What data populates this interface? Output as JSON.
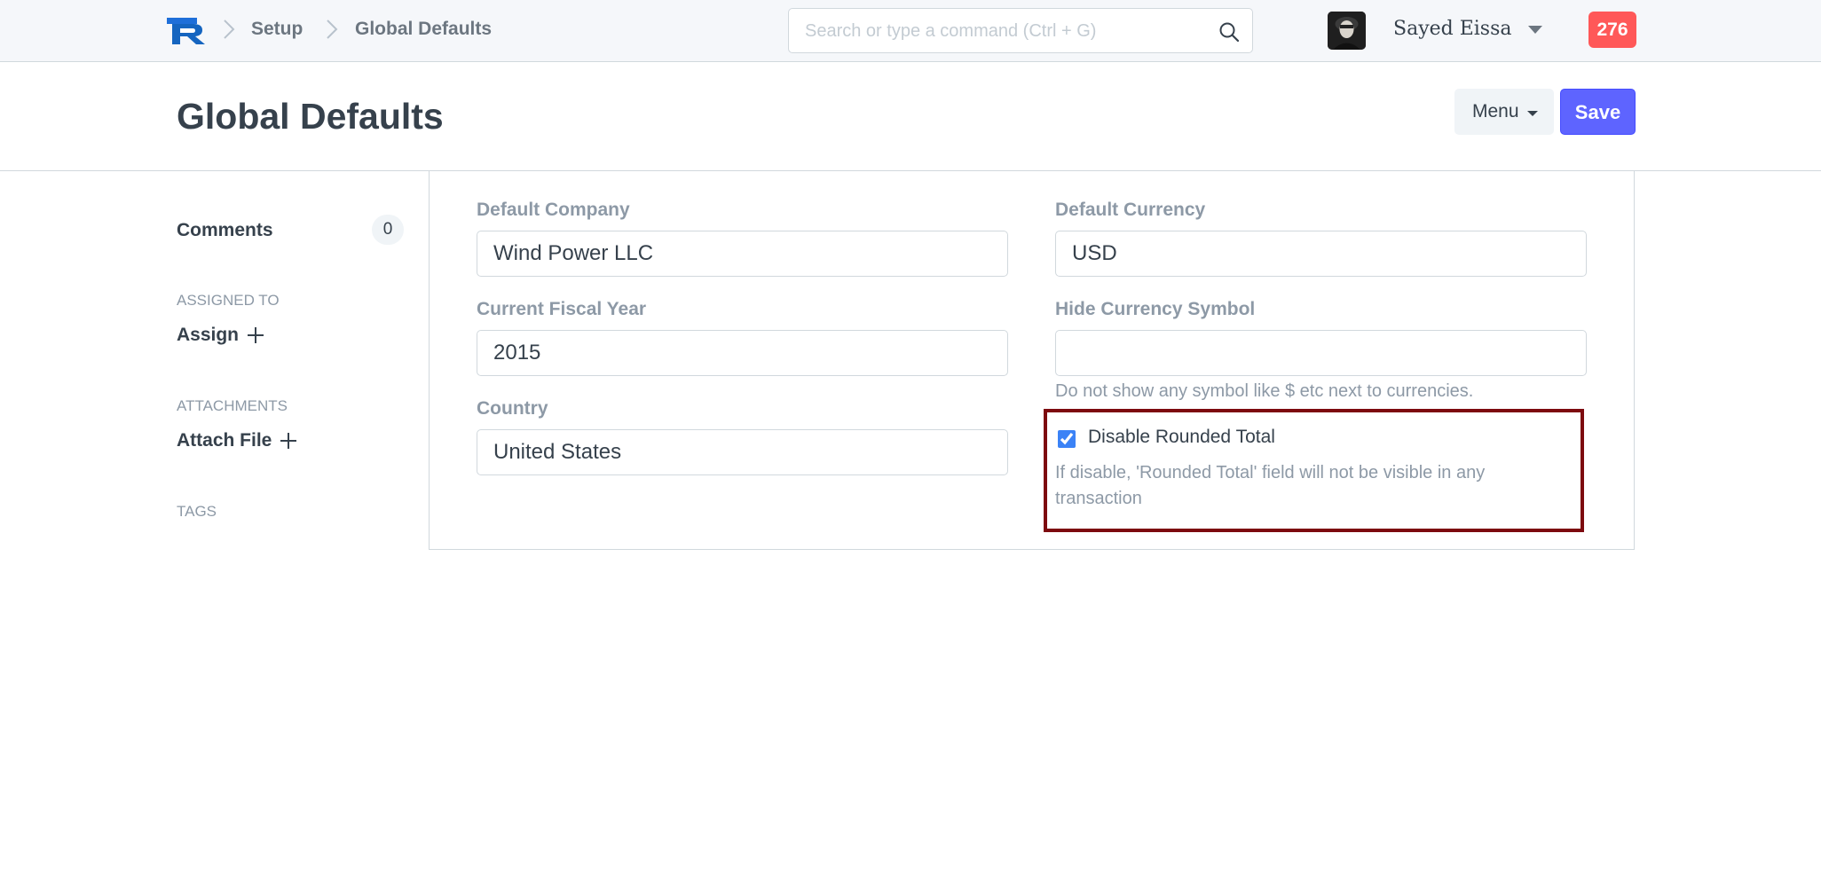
{
  "navbar": {
    "logo_letter": "R",
    "breadcrumbs": [
      "Setup",
      "Global Defaults"
    ],
    "search_placeholder": "Search or type a command (Ctrl + G)",
    "user_name": "Sayed Eissa",
    "notification_count": "276"
  },
  "page": {
    "title": "Global Defaults",
    "menu_label": "Menu",
    "save_label": "Save"
  },
  "sidebar": {
    "comments_label": "Comments",
    "comments_count": "0",
    "assigned_heading": "ASSIGNED TO",
    "assign_label": "Assign",
    "attachments_heading": "ATTACHMENTS",
    "attach_label": "Attach File",
    "tags_heading": "TAGS"
  },
  "form": {
    "default_company": {
      "label": "Default Company",
      "value": "Wind Power LLC"
    },
    "current_fiscal_year": {
      "label": "Current Fiscal Year",
      "value": "2015"
    },
    "country": {
      "label": "Country",
      "value": "United States"
    },
    "default_currency": {
      "label": "Default Currency",
      "value": "USD"
    },
    "hide_currency_symbol": {
      "label": "Hide Currency Symbol",
      "value": "",
      "help": "Do not show any symbol like $ etc next to currencies."
    },
    "disable_rounded_total": {
      "label": "Disable Rounded Total",
      "checked": true,
      "help": "If disable, 'Rounded Total' field will not be visible in any transaction"
    }
  },
  "colors": {
    "save_button": "#5e64ff",
    "notification_badge": "#ff5858",
    "highlight_border": "#7d0a0f",
    "navbar_bg": "#f5f7fa"
  },
  "icons": {
    "search": "search-icon",
    "breadcrumb_separator": "chevron-right-icon",
    "user_menu": "caret-down-icon",
    "add": "plus-icon",
    "checkbox": "checkbox-checked-icon"
  }
}
